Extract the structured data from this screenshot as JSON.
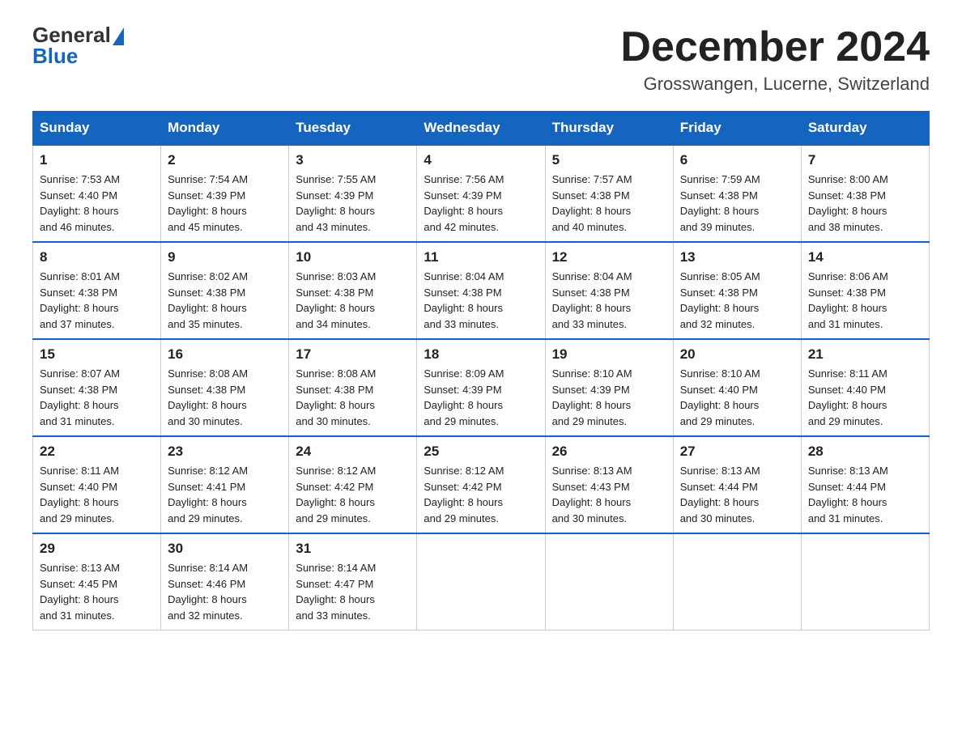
{
  "header": {
    "logo_general": "General",
    "logo_blue": "Blue",
    "month_title": "December 2024",
    "subtitle": "Grosswangen, Lucerne, Switzerland"
  },
  "days_of_week": [
    "Sunday",
    "Monday",
    "Tuesday",
    "Wednesday",
    "Thursday",
    "Friday",
    "Saturday"
  ],
  "weeks": [
    [
      {
        "day": "1",
        "sunrise": "7:53 AM",
        "sunset": "4:40 PM",
        "daylight": "8 hours and 46 minutes."
      },
      {
        "day": "2",
        "sunrise": "7:54 AM",
        "sunset": "4:39 PM",
        "daylight": "8 hours and 45 minutes."
      },
      {
        "day": "3",
        "sunrise": "7:55 AM",
        "sunset": "4:39 PM",
        "daylight": "8 hours and 43 minutes."
      },
      {
        "day": "4",
        "sunrise": "7:56 AM",
        "sunset": "4:39 PM",
        "daylight": "8 hours and 42 minutes."
      },
      {
        "day": "5",
        "sunrise": "7:57 AM",
        "sunset": "4:38 PM",
        "daylight": "8 hours and 40 minutes."
      },
      {
        "day": "6",
        "sunrise": "7:59 AM",
        "sunset": "4:38 PM",
        "daylight": "8 hours and 39 minutes."
      },
      {
        "day": "7",
        "sunrise": "8:00 AM",
        "sunset": "4:38 PM",
        "daylight": "8 hours and 38 minutes."
      }
    ],
    [
      {
        "day": "8",
        "sunrise": "8:01 AM",
        "sunset": "4:38 PM",
        "daylight": "8 hours and 37 minutes."
      },
      {
        "day": "9",
        "sunrise": "8:02 AM",
        "sunset": "4:38 PM",
        "daylight": "8 hours and 35 minutes."
      },
      {
        "day": "10",
        "sunrise": "8:03 AM",
        "sunset": "4:38 PM",
        "daylight": "8 hours and 34 minutes."
      },
      {
        "day": "11",
        "sunrise": "8:04 AM",
        "sunset": "4:38 PM",
        "daylight": "8 hours and 33 minutes."
      },
      {
        "day": "12",
        "sunrise": "8:04 AM",
        "sunset": "4:38 PM",
        "daylight": "8 hours and 33 minutes."
      },
      {
        "day": "13",
        "sunrise": "8:05 AM",
        "sunset": "4:38 PM",
        "daylight": "8 hours and 32 minutes."
      },
      {
        "day": "14",
        "sunrise": "8:06 AM",
        "sunset": "4:38 PM",
        "daylight": "8 hours and 31 minutes."
      }
    ],
    [
      {
        "day": "15",
        "sunrise": "8:07 AM",
        "sunset": "4:38 PM",
        "daylight": "8 hours and 31 minutes."
      },
      {
        "day": "16",
        "sunrise": "8:08 AM",
        "sunset": "4:38 PM",
        "daylight": "8 hours and 30 minutes."
      },
      {
        "day": "17",
        "sunrise": "8:08 AM",
        "sunset": "4:38 PM",
        "daylight": "8 hours and 30 minutes."
      },
      {
        "day": "18",
        "sunrise": "8:09 AM",
        "sunset": "4:39 PM",
        "daylight": "8 hours and 29 minutes."
      },
      {
        "day": "19",
        "sunrise": "8:10 AM",
        "sunset": "4:39 PM",
        "daylight": "8 hours and 29 minutes."
      },
      {
        "day": "20",
        "sunrise": "8:10 AM",
        "sunset": "4:40 PM",
        "daylight": "8 hours and 29 minutes."
      },
      {
        "day": "21",
        "sunrise": "8:11 AM",
        "sunset": "4:40 PM",
        "daylight": "8 hours and 29 minutes."
      }
    ],
    [
      {
        "day": "22",
        "sunrise": "8:11 AM",
        "sunset": "4:40 PM",
        "daylight": "8 hours and 29 minutes."
      },
      {
        "day": "23",
        "sunrise": "8:12 AM",
        "sunset": "4:41 PM",
        "daylight": "8 hours and 29 minutes."
      },
      {
        "day": "24",
        "sunrise": "8:12 AM",
        "sunset": "4:42 PM",
        "daylight": "8 hours and 29 minutes."
      },
      {
        "day": "25",
        "sunrise": "8:12 AM",
        "sunset": "4:42 PM",
        "daylight": "8 hours and 29 minutes."
      },
      {
        "day": "26",
        "sunrise": "8:13 AM",
        "sunset": "4:43 PM",
        "daylight": "8 hours and 30 minutes."
      },
      {
        "day": "27",
        "sunrise": "8:13 AM",
        "sunset": "4:44 PM",
        "daylight": "8 hours and 30 minutes."
      },
      {
        "day": "28",
        "sunrise": "8:13 AM",
        "sunset": "4:44 PM",
        "daylight": "8 hours and 31 minutes."
      }
    ],
    [
      {
        "day": "29",
        "sunrise": "8:13 AM",
        "sunset": "4:45 PM",
        "daylight": "8 hours and 31 minutes."
      },
      {
        "day": "30",
        "sunrise": "8:14 AM",
        "sunset": "4:46 PM",
        "daylight": "8 hours and 32 minutes."
      },
      {
        "day": "31",
        "sunrise": "8:14 AM",
        "sunset": "4:47 PM",
        "daylight": "8 hours and 33 minutes."
      },
      null,
      null,
      null,
      null
    ]
  ],
  "labels": {
    "sunrise": "Sunrise:",
    "sunset": "Sunset:",
    "daylight": "Daylight:"
  }
}
